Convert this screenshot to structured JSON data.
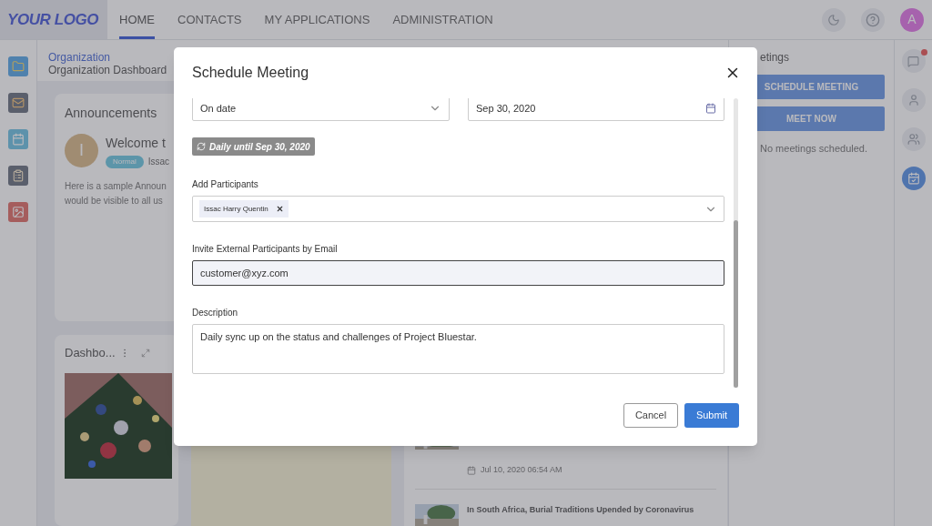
{
  "top_nav": {
    "logo": "YOUR LOGO",
    "tabs": [
      {
        "label": "HOME",
        "selected": true
      },
      {
        "label": "CONTACTS",
        "selected": false
      },
      {
        "label": "MY APPLICATIONS",
        "selected": false
      },
      {
        "label": "ADMINISTRATION",
        "selected": false
      }
    ],
    "avatar": "A"
  },
  "breadcrumb": {
    "section": "Organization",
    "page": "Organization Dashboard"
  },
  "announcements": {
    "title": "Announcements",
    "avatar": "I",
    "heading": "Welcome t",
    "badge": "Normal",
    "author": "Issac",
    "body_lines": [
      "Here is a sample Announ",
      "would be visible to all us"
    ]
  },
  "dashboard_card": {
    "title": "Dashbo...",
    "kind": "picture"
  },
  "news": {
    "items": [
      {
        "date": "Jul 10, 2020 06:54 AM"
      },
      {
        "title": "In South Africa, Burial Traditions Upended by Coronavirus"
      }
    ]
  },
  "meetings": {
    "title": "etings",
    "buttons": [
      "SCHEDULE MEETING",
      "MEET NOW"
    ],
    "empty": "No meetings scheduled."
  },
  "right_rail": {
    "chat_unread": true
  },
  "modal": {
    "title": "Schedule Meeting",
    "repeat_select": {
      "value": "On date"
    },
    "end_date": {
      "value": "Sep 30, 2020"
    },
    "recurrence": "Daily until Sep 30, 2020",
    "participants": {
      "label": "Add Participants",
      "chips": [
        {
          "name": "Issac Harry Quentin"
        }
      ]
    },
    "email": {
      "label": "Invite External Participants by Email",
      "value": "customer@xyz.com",
      "focused": true
    },
    "description": {
      "label": "Description",
      "value": "Daily sync up on the status and challenges of Project Bluestar."
    },
    "buttons": {
      "cancel": "Cancel",
      "submit": "Submit"
    }
  }
}
